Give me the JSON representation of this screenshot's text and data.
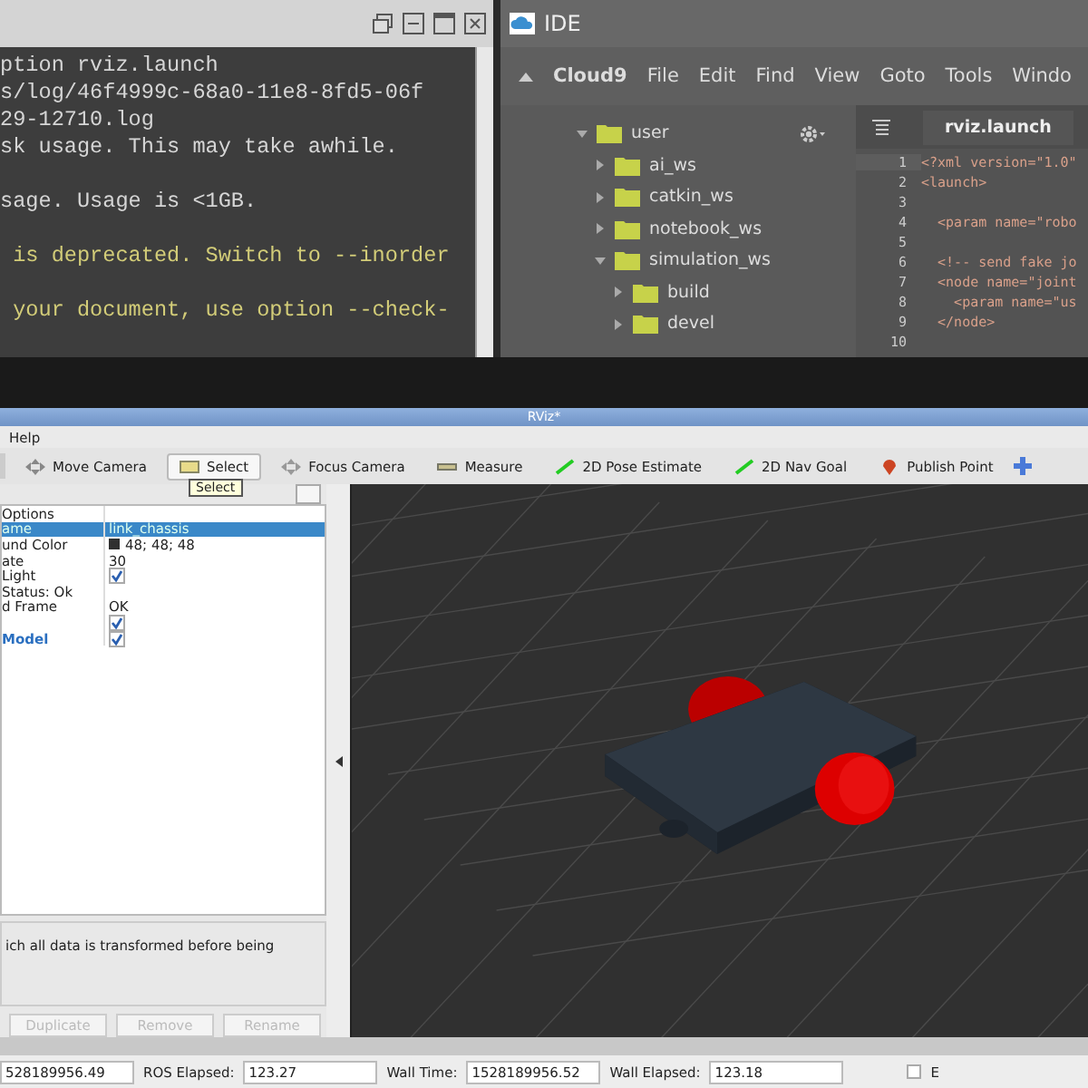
{
  "terminal": {
    "lines": [
      {
        "text": "ption rviz.launch",
        "kind": "normal"
      },
      {
        "text": "s/log/46f4999c-68a0-11e8-8fd5-06f",
        "kind": "normal"
      },
      {
        "text": "29-12710.log",
        "kind": "normal"
      },
      {
        "text": "sk usage. This may take awhile.",
        "kind": "normal"
      },
      {
        "kind": "blank"
      },
      {
        "text": "sage. Usage is <1GB.",
        "kind": "normal"
      },
      {
        "kind": "blank"
      },
      {
        "text": " is deprecated. Switch to --inorder",
        "kind": "warning"
      },
      {
        "kind": "blank"
      },
      {
        "text": " your document, use option --check-",
        "kind": "warning"
      }
    ]
  },
  "ide": {
    "title": "IDE",
    "menu": [
      "Cloud9",
      "File",
      "Edit",
      "Find",
      "View",
      "Goto",
      "Tools",
      "Windo"
    ],
    "tree": [
      {
        "name": "user",
        "expanded": true,
        "children": [
          {
            "name": "ai_ws",
            "expanded": false
          },
          {
            "name": "catkin_ws",
            "expanded": false
          },
          {
            "name": "notebook_ws",
            "expanded": false
          },
          {
            "name": "simulation_ws",
            "expanded": true,
            "children": [
              {
                "name": "build",
                "expanded": false
              },
              {
                "name": "devel",
                "expanded": false
              }
            ]
          }
        ]
      }
    ],
    "tab": "rviz.launch",
    "code": [
      {
        "num": "1",
        "text": "<?xml version=\"1.0\""
      },
      {
        "num": "2",
        "text": "<launch>"
      },
      {
        "num": "3"
      },
      {
        "num": "4",
        "text": "  <param name=\"robo"
      },
      {
        "num": "5"
      },
      {
        "num": "6",
        "text": "  <!-- send fake jo"
      },
      {
        "num": "7",
        "text": "  <node name=\"joint"
      },
      {
        "num": "8",
        "text": "    <param name=\"us"
      },
      {
        "num": "9",
        "text": "  </node>"
      },
      {
        "num": "10"
      }
    ]
  },
  "rviz": {
    "title": "RViz*",
    "menu": [
      "Help"
    ],
    "tools": [
      {
        "label": "Move Camera",
        "kind": "move",
        "selected": false
      },
      {
        "label": "Select",
        "kind": "select",
        "selected": true
      },
      {
        "label": "Focus Camera",
        "kind": "focus",
        "selected": false
      },
      {
        "label": "Measure",
        "kind": "measure",
        "selected": false
      },
      {
        "label": "2D Pose Estimate",
        "kind": "pose",
        "selected": false
      },
      {
        "label": "2D Nav Goal",
        "kind": "nav",
        "selected": false
      },
      {
        "label": "Publish Point",
        "kind": "point",
        "selected": false
      }
    ],
    "tooltip": "Select",
    "properties": [
      {
        "name": "Options",
        "kind": "text",
        "selected": false
      },
      {
        "name": "ame",
        "value": "link_chassis",
        "kind": "text",
        "selected": true
      },
      {
        "name": "und Color",
        "value": "48; 48; 48",
        "kind": "color",
        "selected": false,
        "color": "#303030"
      },
      {
        "name": "ate",
        "value": "30",
        "kind": "text",
        "selected": false
      },
      {
        "name": "Light",
        "kind": "check",
        "checked": true,
        "selected": false
      },
      {
        "name": "Status: Ok",
        "kind": "text",
        "selected": false
      },
      {
        "name": "d Frame",
        "value": "OK",
        "kind": "text",
        "selected": false
      },
      {
        "kind": "check",
        "checked": true,
        "selected": false
      },
      {
        "name": "Model",
        "kind": "check",
        "checked": true,
        "selected": false,
        "highlight": true
      }
    ],
    "description": "ich all data is transformed before being",
    "buttons": [
      {
        "label": "Duplicate",
        "disabled": true
      },
      {
        "label": "Remove",
        "disabled": true
      },
      {
        "label": "Rename",
        "disabled": true
      }
    ],
    "status": [
      {
        "value": "528189956.49"
      },
      {
        "label": "ROS Elapsed:",
        "value": "123.27"
      },
      {
        "label": "Wall Time:",
        "value": "1528189956.52"
      },
      {
        "label": "Wall Elapsed:",
        "value": "123.18"
      }
    ],
    "status_check": {
      "label": "E",
      "checked": false
    }
  }
}
